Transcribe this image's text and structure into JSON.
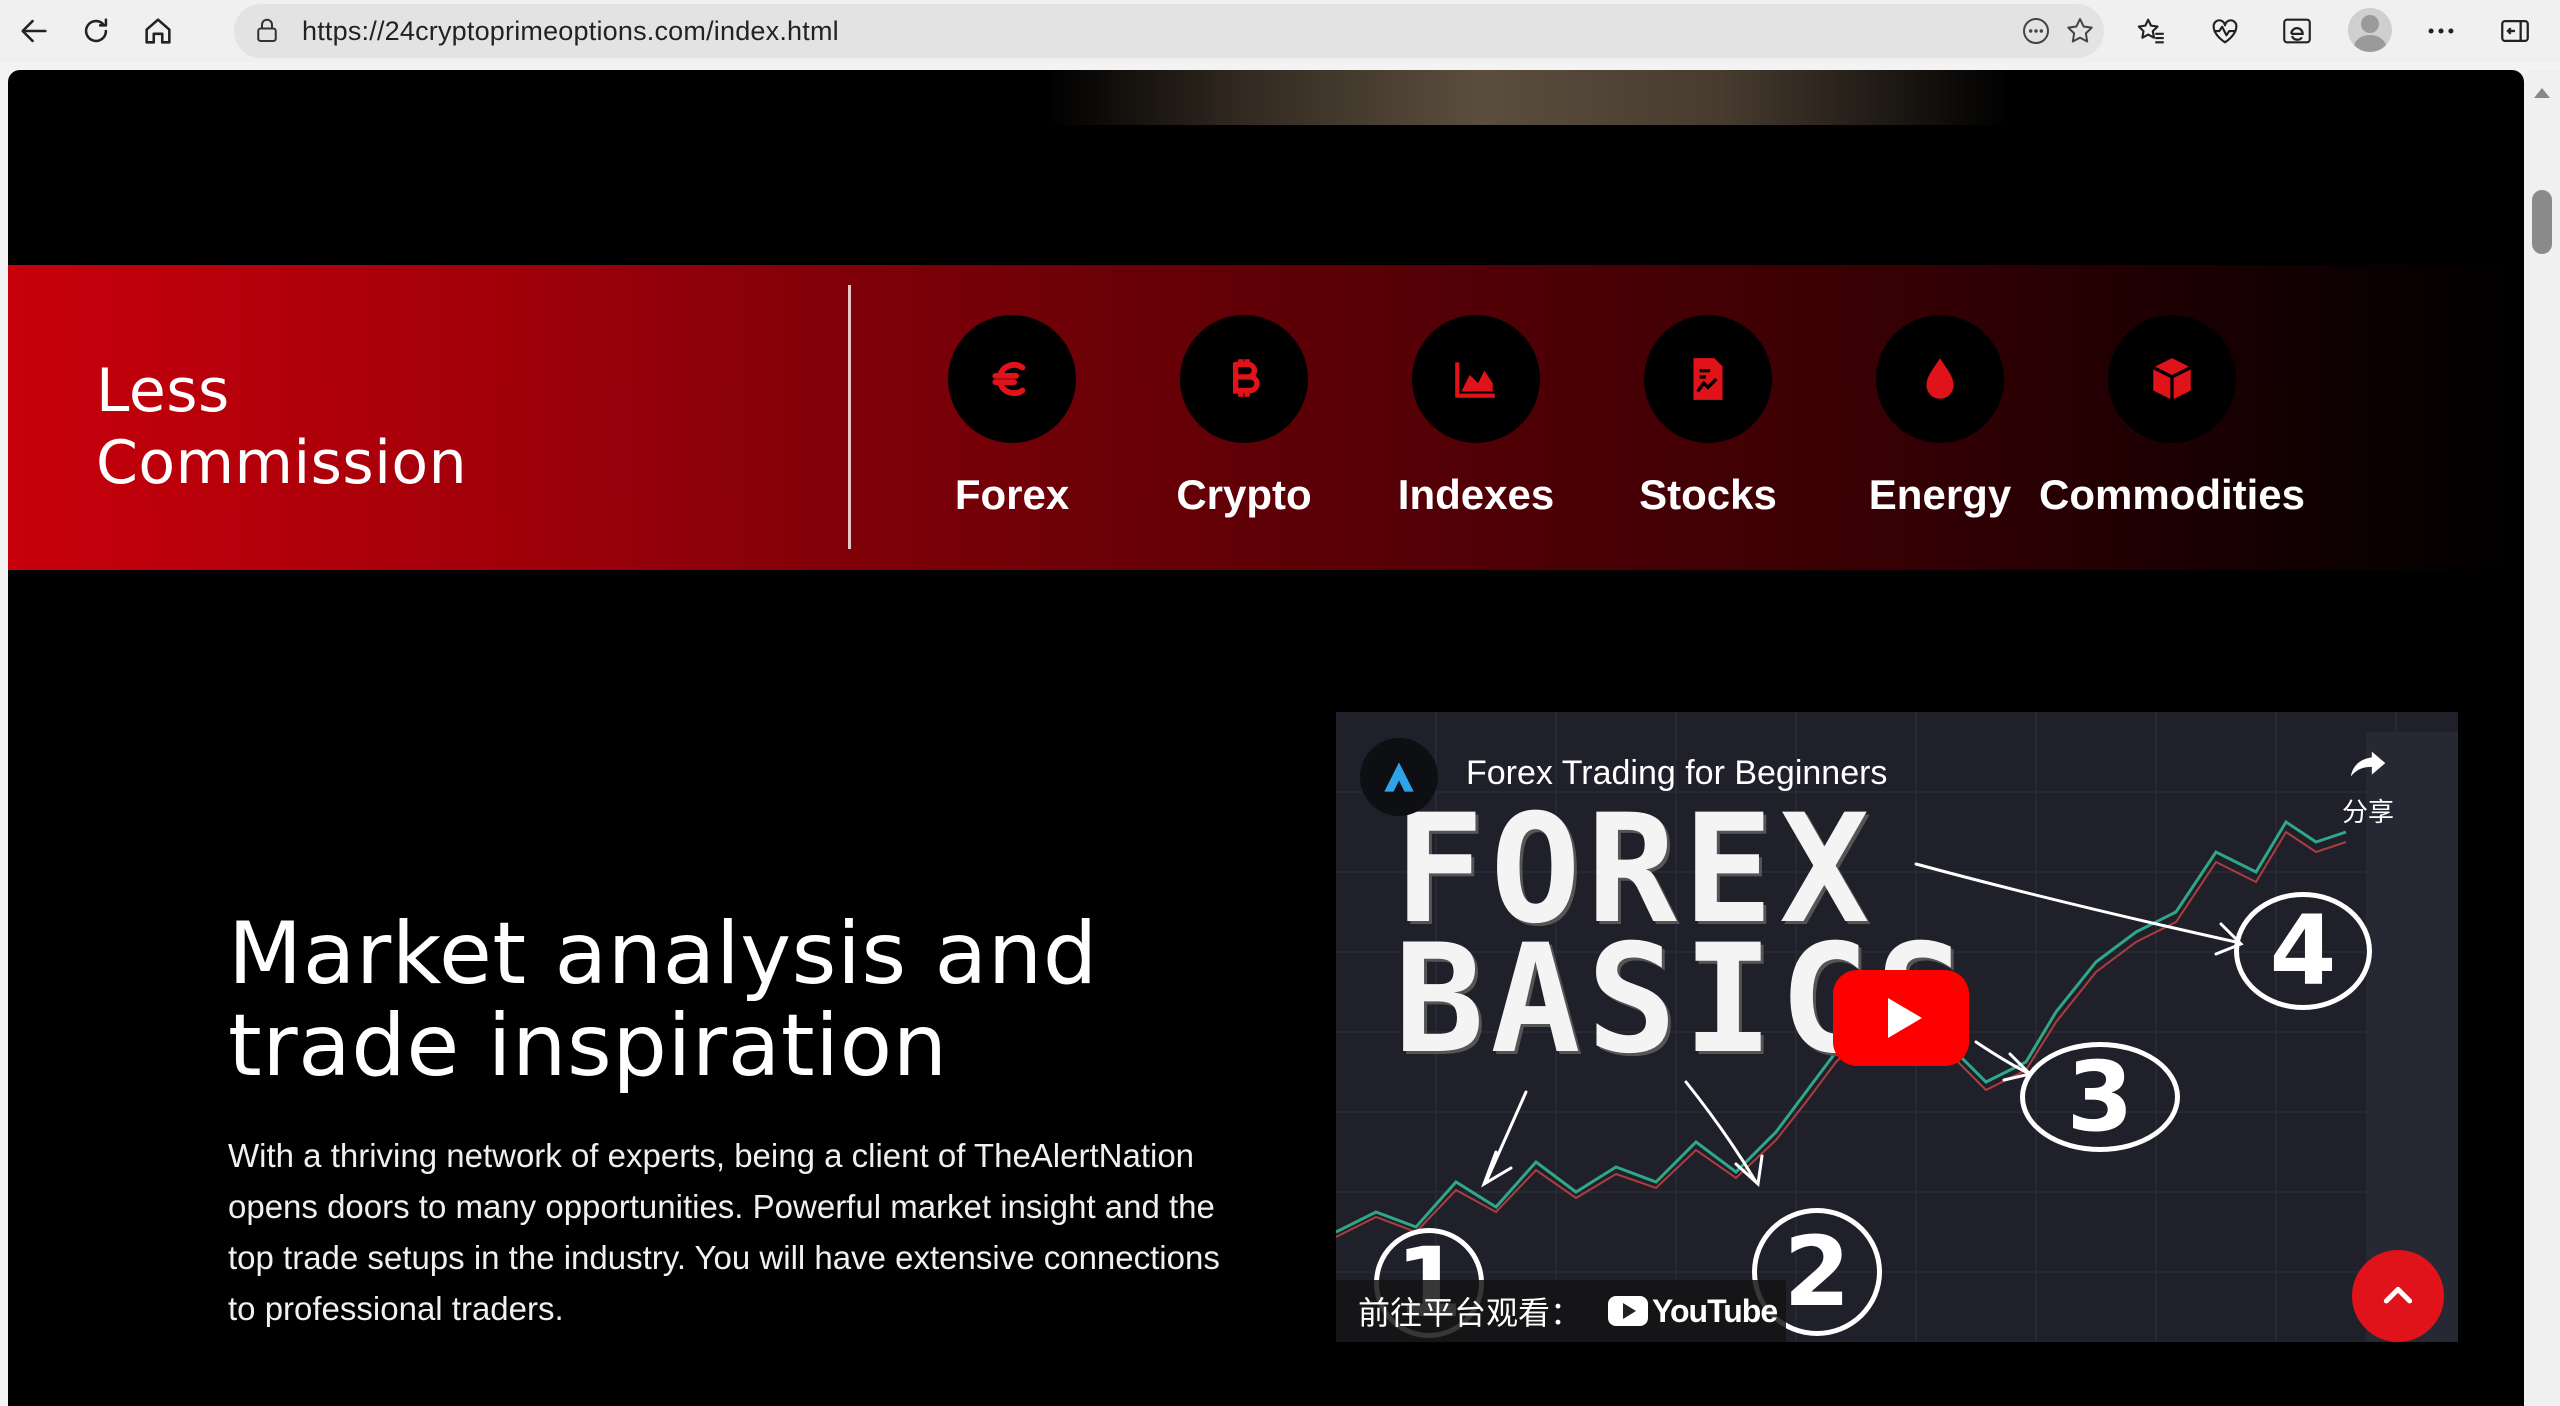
{
  "browser": {
    "url": "https://24cryptoprimeoptions.com/index.html",
    "icons": [
      "back-icon",
      "refresh-icon",
      "home-icon",
      "site-info-icon",
      "more-options-icon",
      "favorite-star-icon",
      "favorites-icon",
      "health-icon",
      "ie-mode-icon",
      "profile-avatar",
      "settings-menu-icon",
      "sidebar-icon"
    ]
  },
  "band": {
    "title_line1": "Less",
    "title_line2": "Commission",
    "markets": [
      {
        "label": "Forex",
        "icon": "euro-icon"
      },
      {
        "label": "Crypto",
        "icon": "bitcoin-icon"
      },
      {
        "label": "Indexes",
        "icon": "area-chart-icon"
      },
      {
        "label": "Stocks",
        "icon": "document-chart-icon"
      },
      {
        "label": "Energy",
        "icon": "drop-icon"
      },
      {
        "label": "Commodities",
        "icon": "cube-icon"
      }
    ],
    "accent": "#c8000b"
  },
  "content": {
    "headline_line1": "Market analysis and",
    "headline_line2": "trade inspiration",
    "paragraph": "With a thriving network of experts, being a client of TheAlertNation opens doors to many opportunities. Powerful market insight and the top trade setups in the industry. You will have extensive connections to professional traders."
  },
  "video": {
    "title": "Forex Trading for Beginners",
    "share_label": "分享",
    "overlay_line1": "FOREX",
    "overlay_line2": "BASICS",
    "steps": [
      "1",
      "2",
      "3",
      "4"
    ],
    "watch_on": "前往平台观看：",
    "platform": "YouTube",
    "play_color": "#ff0000"
  }
}
